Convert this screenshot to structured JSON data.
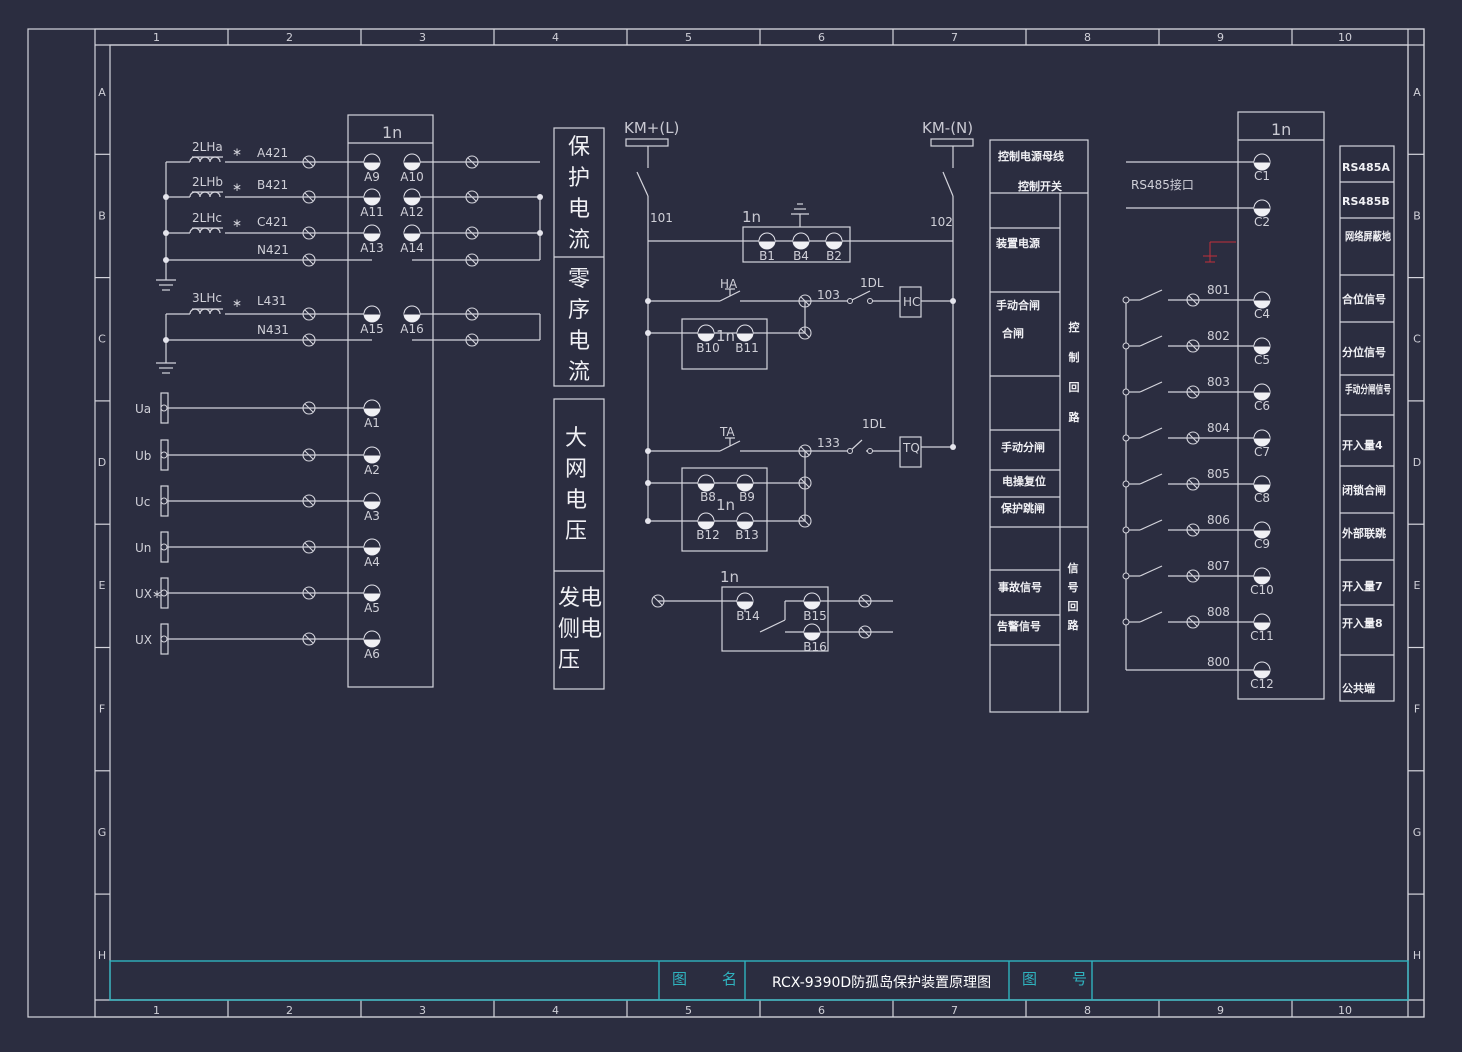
{
  "frame": {
    "col_numbers": [
      "1",
      "2",
      "3",
      "4",
      "5",
      "6",
      "7",
      "8",
      "9",
      "10"
    ],
    "row_letters": [
      "A",
      "B",
      "C",
      "D",
      "E",
      "F",
      "G",
      "H"
    ]
  },
  "left_block": {
    "title": "1n",
    "ct_labels": [
      "2LHa",
      "2LHb",
      "2LHc",
      "3LHc"
    ],
    "wire_labels": [
      "A421",
      "B421",
      "C421",
      "N421",
      "L431",
      "N431"
    ],
    "terminals_top": [
      "A9",
      "A10",
      "A11",
      "A12",
      "A13",
      "A14",
      "A15",
      "A16"
    ],
    "voltage_labels": [
      "Ua",
      "Ub",
      "Uc",
      "Un",
      "UX∗",
      "UX"
    ],
    "voltage_terminals": [
      "A1",
      "A2",
      "A3",
      "A4",
      "A5",
      "A6"
    ],
    "star": "∗"
  },
  "section_titles": {
    "protection_current": [
      "保",
      "护",
      "电",
      "流"
    ],
    "zero_seq_current": [
      "零",
      "序",
      "电",
      "流"
    ],
    "grid_voltage": [
      "大",
      "网",
      "电",
      "压"
    ],
    "gen_side_voltage": [
      "发电",
      "侧电",
      "压"
    ]
  },
  "control_circuit": {
    "km_plus": "KM+(L)",
    "km_minus": "KM-(N)",
    "node_101": "101",
    "node_102": "102",
    "node_103": "103",
    "node_133": "133",
    "module": "1n",
    "b_terms_1": [
      "B1",
      "B4",
      "B2"
    ],
    "ha": "HA",
    "hc": "HC",
    "idl": "1DL",
    "b_terms_2": [
      "B10",
      "B11"
    ],
    "ta": "TA",
    "tq": "TQ",
    "b_terms_3": [
      "B8",
      "B9",
      "B12",
      "B13"
    ],
    "b_terms_4": [
      "B14",
      "B15",
      "B16"
    ]
  },
  "control_table": {
    "rows": [
      "控制电源母线",
      "控制开关",
      "装置电源",
      "手动合闸",
      "合闸",
      "手动分闸",
      "电操复位",
      "保护跳闸",
      "事故信号",
      "告警信号"
    ],
    "side_control": [
      "控",
      "制",
      "回",
      "路"
    ],
    "side_signal": [
      "信",
      "号",
      "回",
      "路"
    ]
  },
  "right_block": {
    "title": "1n",
    "rs485_label": "RS485接口",
    "c_terms": [
      "C1",
      "C2",
      "C4",
      "C5",
      "C6",
      "C7",
      "C8",
      "C9",
      "C10",
      "C11",
      "C12"
    ],
    "nodes": [
      "801",
      "802",
      "803",
      "804",
      "805",
      "806",
      "807",
      "808",
      "800"
    ],
    "signals": [
      "RS485A",
      "RS485B",
      "网络屏蔽地",
      "合位信号",
      "分位信号",
      "手动分闸信号",
      "开入量4",
      "闭锁合闸",
      "外部联跳",
      "开入量7",
      "开入量8",
      "公共端"
    ]
  },
  "title_block": {
    "label_name_a": "图",
    "label_name_b": "名",
    "drawing_name": "RCX-9390D防孤岛保护装置原理图",
    "label_no_a": "图",
    "label_no_b": "号"
  }
}
